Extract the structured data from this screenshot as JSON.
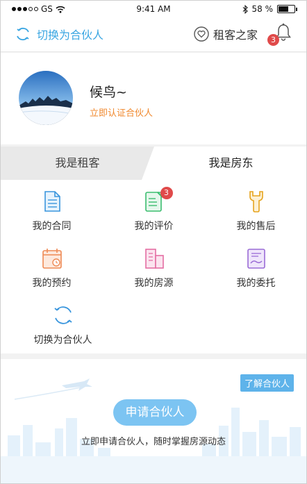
{
  "status": {
    "carrier": "GS",
    "time": "9:41 AM",
    "battery": "58 %",
    "battery_level": 0.58
  },
  "nav": {
    "switch_label": "切换为合伙人",
    "home_label": "租客之家",
    "bell_badge": "3"
  },
  "profile": {
    "name": "候鸟~",
    "certify": "立即认证合伙人"
  },
  "tabs": {
    "tenant": "我是租客",
    "landlord": "我是房东"
  },
  "grid": {
    "contract": "我的合同",
    "review": "我的评价",
    "review_badge": "3",
    "aftersale": "我的售后",
    "appointment": "我的预约",
    "listing": "我的房源",
    "entrust": "我的委托",
    "switch": "切换为合伙人"
  },
  "banner": {
    "learn": "了解合伙人",
    "apply": "申请合伙人",
    "desc": "立即申请合伙人，随时掌握房源动态"
  },
  "colors": {
    "accent": "#3aa6e2",
    "orange": "#f0882d",
    "badge": "#e04a4a"
  }
}
